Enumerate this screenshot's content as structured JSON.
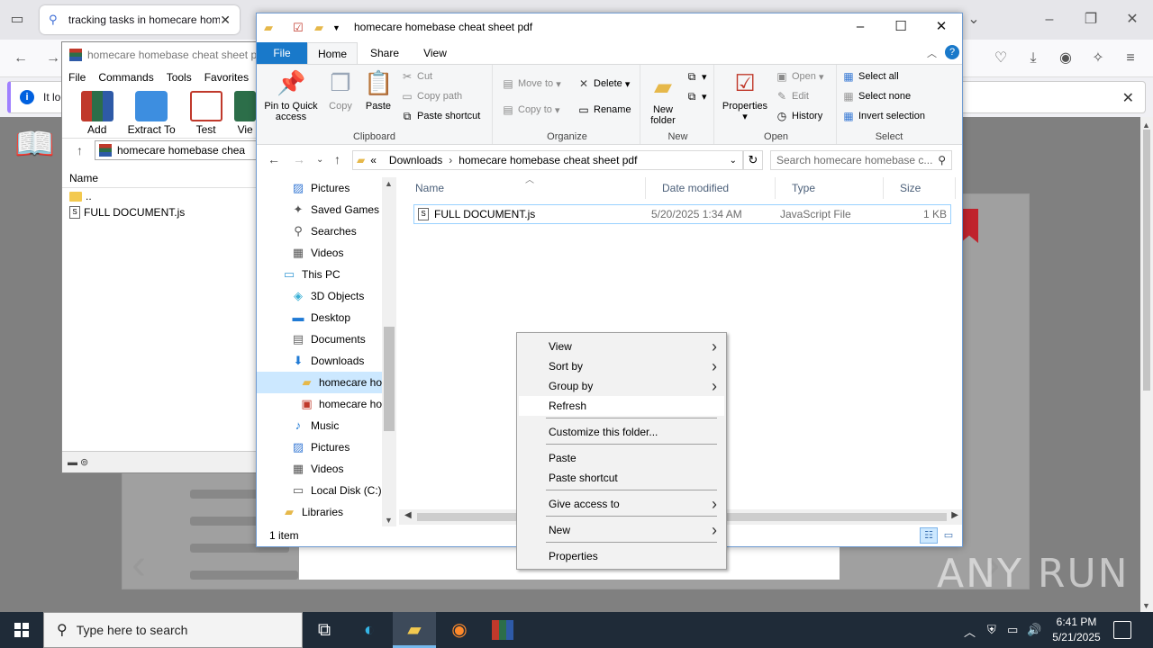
{
  "browser": {
    "tabs": [
      {
        "title": "tracking tasks in homecare hom",
        "close": "✕"
      },
      {
        "title": "",
        "close": ""
      }
    ],
    "infobar_text": "It loo",
    "watermark": "ANY RUN"
  },
  "winrar": {
    "title": "homecare homebase cheat sheet p",
    "menu": [
      "File",
      "Commands",
      "Tools",
      "Favorites"
    ],
    "tools": [
      "Add",
      "Extract To",
      "Test",
      "Vie"
    ],
    "address": "homecare homebase chea",
    "column_name": "Name",
    "rows": [
      "..",
      "FULL DOCUMENT.js"
    ]
  },
  "explorer": {
    "title": "homecare homebase cheat sheet pdf",
    "ribbon_tabs": [
      "File",
      "Home",
      "Share",
      "View"
    ],
    "ribbon": {
      "clipboard": {
        "label": "Clipboard",
        "pin": "Pin to Quick access",
        "copy": "Copy",
        "paste": "Paste",
        "cut": "Cut",
        "copy_path": "Copy path",
        "paste_shortcut": "Paste shortcut"
      },
      "organize": {
        "label": "Organize",
        "move_to": "Move to",
        "copy_to": "Copy to",
        "delete": "Delete",
        "rename": "Rename"
      },
      "new": {
        "label": "New",
        "new_folder": "New folder"
      },
      "open": {
        "label": "Open",
        "properties": "Properties",
        "open": "Open",
        "edit": "Edit",
        "history": "History"
      },
      "select": {
        "label": "Select",
        "select_all": "Select all",
        "select_none": "Select none",
        "invert": "Invert selection"
      }
    },
    "address": {
      "prefix": "«",
      "crumbs": [
        "Downloads",
        "homecare homebase cheat sheet pdf"
      ]
    },
    "search_placeholder": "Search homecare homebase c...",
    "nav_items": [
      {
        "label": "Pictures",
        "icon": "pictures-icon"
      },
      {
        "label": "Saved Games",
        "icon": "saved-games-icon"
      },
      {
        "label": "Searches",
        "icon": "searches-icon"
      },
      {
        "label": "Videos",
        "icon": "videos-icon"
      },
      {
        "label": "This PC",
        "icon": "computer-icon"
      },
      {
        "label": "3D Objects",
        "icon": "3d-objects-icon"
      },
      {
        "label": "Desktop",
        "icon": "desktop-icon"
      },
      {
        "label": "Documents",
        "icon": "documents-icon"
      },
      {
        "label": "Downloads",
        "icon": "downloads-icon"
      },
      {
        "label": "homecare ho",
        "icon": "folder-icon"
      },
      {
        "label": "homecare ho",
        "icon": "winrar-icon"
      },
      {
        "label": "Music",
        "icon": "music-icon"
      },
      {
        "label": "Pictures",
        "icon": "pictures-icon"
      },
      {
        "label": "Videos",
        "icon": "videos-icon"
      },
      {
        "label": "Local Disk (C:)",
        "icon": "disk-icon"
      },
      {
        "label": "Libraries",
        "icon": "libraries-icon"
      }
    ],
    "columns": [
      "Name",
      "Date modified",
      "Type",
      "Size"
    ],
    "files": [
      {
        "name": "FULL DOCUMENT.js",
        "date": "5/20/2025 1:34 AM",
        "type": "JavaScript File",
        "size": "1 KB"
      }
    ],
    "status": "1 item"
  },
  "context_menu": [
    {
      "label": "View",
      "submenu": true
    },
    {
      "label": "Sort by",
      "submenu": true
    },
    {
      "label": "Group by",
      "submenu": true
    },
    {
      "label": "Refresh",
      "submenu": false
    },
    {
      "label": "Customize this folder...",
      "submenu": false
    },
    {
      "label": "Paste",
      "submenu": false
    },
    {
      "label": "Paste shortcut",
      "submenu": false
    },
    {
      "label": "Give access to",
      "submenu": true
    },
    {
      "label": "New",
      "submenu": true
    },
    {
      "label": "Properties",
      "submenu": false
    }
  ],
  "taskbar": {
    "search_placeholder": "Type here to search",
    "time": "6:41 PM",
    "date": "5/21/2025"
  },
  "colors": {
    "file_tab": "#1979ca",
    "selection": "#cce8ff",
    "taskbar": "#1f2b38"
  }
}
